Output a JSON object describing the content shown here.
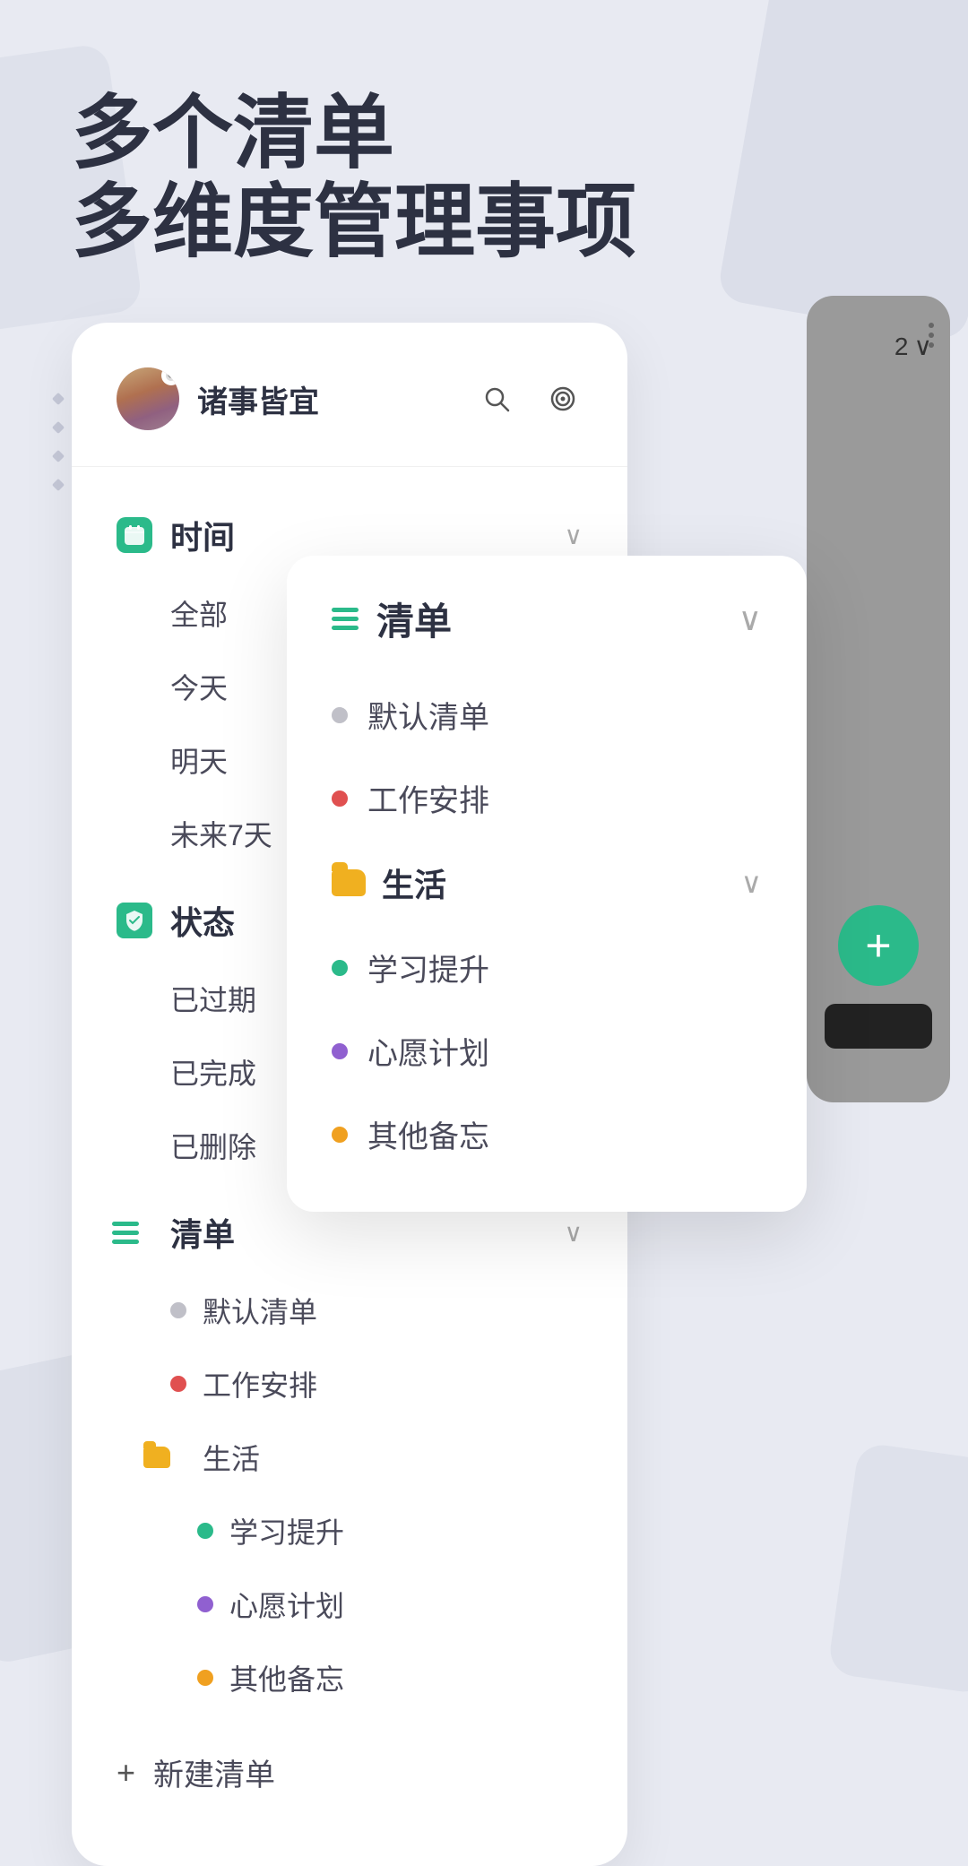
{
  "page": {
    "background_color": "#e8eaf2"
  },
  "header": {
    "title_line1": "多个清单",
    "title_line2": "多维度管理事项"
  },
  "app": {
    "user_name": "诸事皆宜",
    "search_icon": "search-icon",
    "target_icon": "target-icon",
    "more_icon": "more-icon"
  },
  "sidebar": {
    "categories": [
      {
        "id": "time",
        "icon": "calendar-icon",
        "label": "时间",
        "color": "#2bba8a",
        "expanded": true,
        "items": [
          {
            "label": "全部"
          },
          {
            "label": "今天"
          },
          {
            "label": "明天"
          },
          {
            "label": "未来7天"
          }
        ]
      },
      {
        "id": "status",
        "icon": "status-icon",
        "label": "状态",
        "color": "#2bba8a",
        "expanded": true,
        "items": [
          {
            "label": "已过期"
          },
          {
            "label": "已完成"
          },
          {
            "label": "已删除"
          }
        ]
      },
      {
        "id": "list",
        "icon": "list-icon",
        "label": "清单",
        "color": "#2bba8a",
        "expanded": true,
        "items": [
          {
            "label": "默认清单",
            "dot": "gray"
          },
          {
            "label": "工作安排",
            "dot": "red"
          }
        ],
        "groups": [
          {
            "label": "生活",
            "icon": "folder-icon",
            "color": "#f0b020",
            "expanded": true,
            "items": [
              {
                "label": "学习提升",
                "dot": "green"
              },
              {
                "label": "心愿计划",
                "dot": "purple"
              },
              {
                "label": "其他备忘",
                "dot": "orange"
              }
            ]
          }
        ]
      }
    ],
    "new_list_label": "新建清单"
  },
  "dropdown": {
    "title": "清单",
    "items": [
      {
        "label": "默认清单",
        "dot": "gray"
      },
      {
        "label": "工作安排",
        "dot": "red"
      }
    ],
    "groups": [
      {
        "label": "生活",
        "icon": "folder-icon",
        "color": "#f0b020",
        "items": [
          {
            "label": "学习提升",
            "dot": "green"
          },
          {
            "label": "心愿计划",
            "dot": "purple"
          },
          {
            "label": "其他备忘",
            "dot": "orange"
          }
        ]
      }
    ]
  },
  "phone": {
    "counter": "2",
    "add_button_label": "+",
    "more_dots": "..."
  },
  "colors": {
    "accent": "#2bba8a",
    "text_primary": "#2d3142",
    "text_secondary": "#4a4a5a",
    "dot_gray": "#c0c0c8",
    "dot_red": "#e05050",
    "dot_green": "#2bba8a",
    "dot_purple": "#9060d0",
    "dot_orange": "#f0a020",
    "folder_yellow": "#f0b020"
  }
}
